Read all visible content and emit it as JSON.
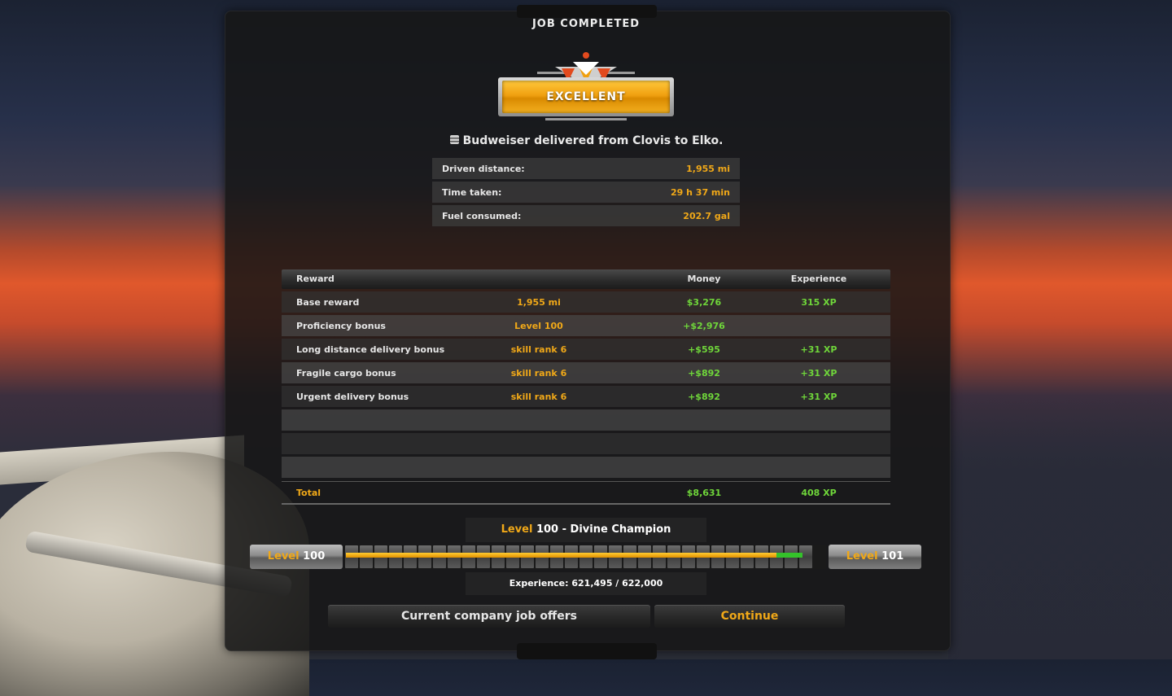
{
  "screen": {
    "title": "JOB COMPLETED",
    "rating": "EXCELLENT",
    "delivery_message": "Budweiser delivered from Clovis to Elko."
  },
  "stats": [
    {
      "label": "Driven distance:",
      "value": "1,955 mi"
    },
    {
      "label": "Time taken:",
      "value": "29 h 37 min"
    },
    {
      "label": "Fuel consumed:",
      "value": "202.7 gal"
    }
  ],
  "rewards": {
    "headers": {
      "reward": "Reward",
      "money": "Money",
      "experience": "Experience"
    },
    "rows": [
      {
        "name": "Base reward",
        "detail": "1,955 mi",
        "money": "$3,276",
        "xp": "315 XP"
      },
      {
        "name": "Proficiency bonus",
        "detail": "Level 100",
        "money": "+$2,976",
        "xp": ""
      },
      {
        "name": "Long distance delivery bonus",
        "detail": "skill rank 6",
        "money": "+$595",
        "xp": "+31 XP"
      },
      {
        "name": "Fragile cargo bonus",
        "detail": "skill rank 6",
        "money": "+$892",
        "xp": "+31 XP"
      },
      {
        "name": "Urgent delivery bonus",
        "detail": "skill rank 6",
        "money": "+$892",
        "xp": "+31 XP"
      }
    ],
    "total": {
      "label": "Total",
      "money": "$8,631",
      "xp": "408 XP"
    }
  },
  "level": {
    "prefix": "Level",
    "current": "100",
    "rank_suffix": " - Divine Champion",
    "next": "101",
    "progress_before": 0.9,
    "progress_after": 0.955,
    "experience_text": "Experience: 621,495 / 622,000"
  },
  "buttons": {
    "job_offers": "Current company job offers",
    "continue": "Continue"
  },
  "colors": {
    "accent_gold": "#f0a818",
    "xp_green": "#6fd63a",
    "badge_orange": "#f0a010"
  },
  "icons": {
    "cargo": "keg-icon",
    "rating": "excellent-emblem-icon"
  }
}
